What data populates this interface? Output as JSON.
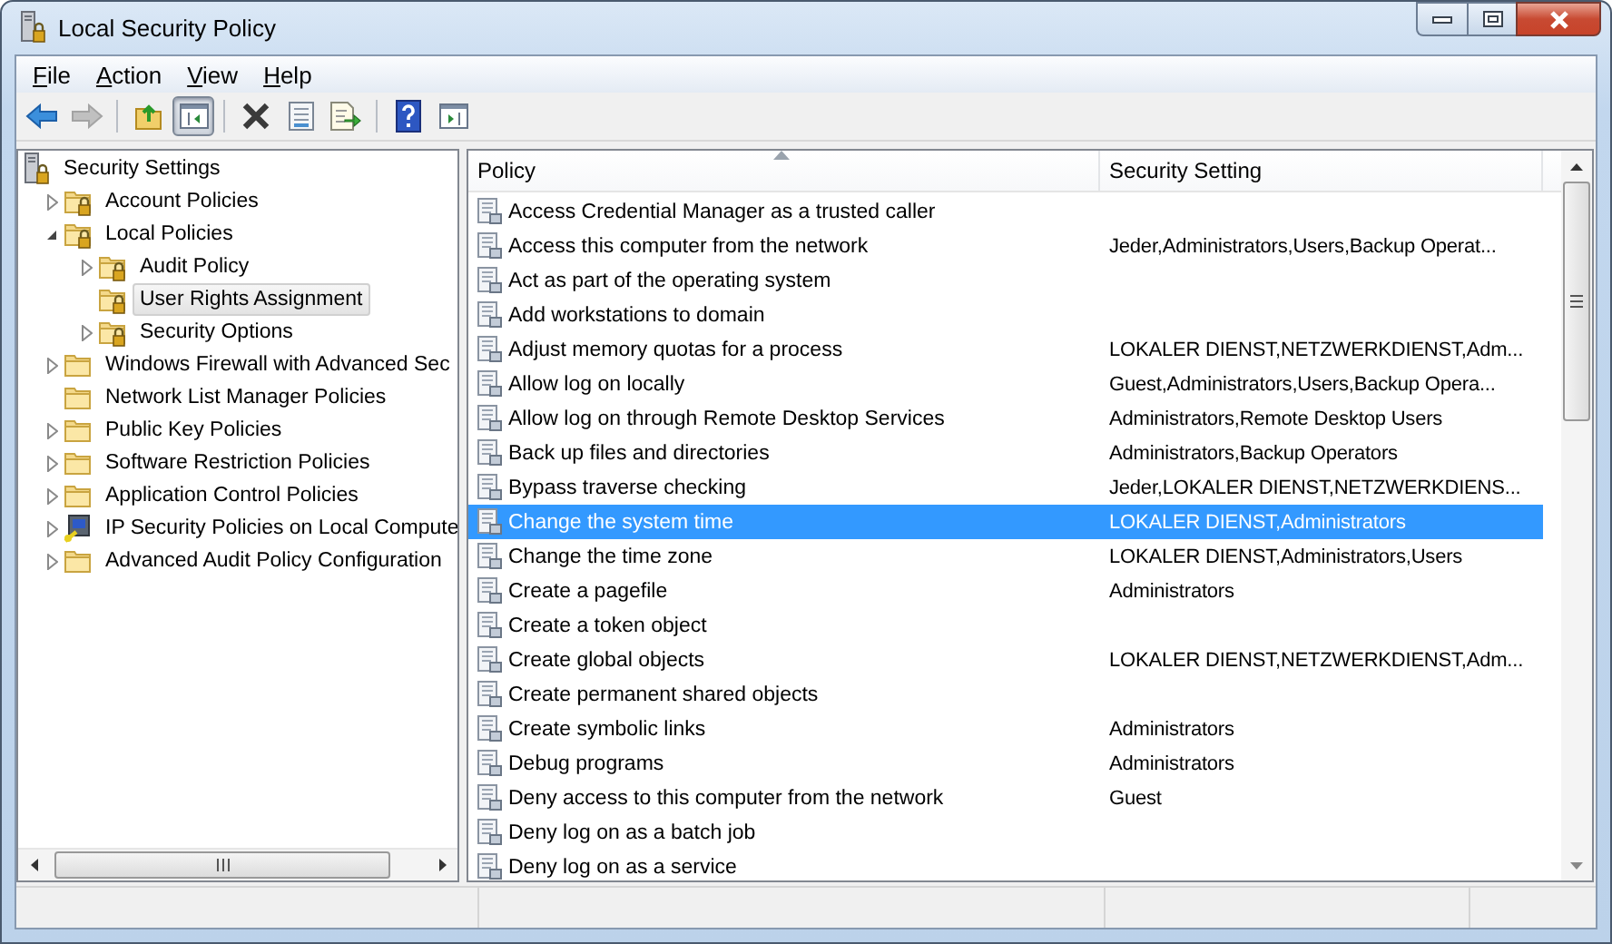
{
  "window": {
    "title": "Local Security Policy"
  },
  "menu": [
    "File",
    "Action",
    "View",
    "Help"
  ],
  "toolbar": [
    {
      "kind": "back",
      "disabled": false,
      "pressed": false
    },
    {
      "kind": "forward",
      "disabled": true,
      "pressed": false
    },
    {
      "kind": "separator"
    },
    {
      "kind": "up",
      "disabled": false,
      "pressed": false
    },
    {
      "kind": "tree-toggle",
      "disabled": false,
      "pressed": true
    },
    {
      "kind": "separator"
    },
    {
      "kind": "delete",
      "disabled": false,
      "pressed": false
    },
    {
      "kind": "properties",
      "disabled": false,
      "pressed": false
    },
    {
      "kind": "export",
      "disabled": false,
      "pressed": false
    },
    {
      "kind": "separator"
    },
    {
      "kind": "help",
      "disabled": false,
      "pressed": false
    },
    {
      "kind": "action-pane",
      "disabled": false,
      "pressed": false
    }
  ],
  "tree": [
    {
      "label": "Security Settings",
      "kind": "root",
      "selected": false,
      "children": [
        {
          "label": "Account Policies",
          "kind": "secure-folder",
          "expanded": false,
          "selected": false
        },
        {
          "label": "Local Policies",
          "kind": "secure-folder",
          "expanded": true,
          "selected": false,
          "children": [
            {
              "label": "Audit Policy",
              "kind": "secure-folder",
              "expanded": false,
              "selected": false
            },
            {
              "label": "User Rights Assignment",
              "kind": "secure-folder",
              "selected": true
            },
            {
              "label": "Security Options",
              "kind": "secure-folder",
              "expanded": false,
              "selected": false
            }
          ]
        },
        {
          "label": "Windows Firewall with Advanced Sec",
          "kind": "folder",
          "expanded": false,
          "selected": false
        },
        {
          "label": "Network List Manager Policies",
          "kind": "folder",
          "selected": false
        },
        {
          "label": "Public Key Policies",
          "kind": "folder",
          "expanded": false,
          "selected": false
        },
        {
          "label": "Software Restriction Policies",
          "kind": "folder",
          "expanded": false,
          "selected": false
        },
        {
          "label": "Application Control Policies",
          "kind": "folder",
          "expanded": false,
          "selected": false
        },
        {
          "label": "IP Security Policies on Local Compute",
          "kind": "ipsec",
          "expanded": false,
          "selected": false
        },
        {
          "label": "Advanced Audit Policy Configuration",
          "kind": "folder",
          "expanded": false,
          "selected": false
        }
      ]
    }
  ],
  "table": {
    "columns": [
      {
        "label": "Policy",
        "sorted": true
      },
      {
        "label": "Security Setting",
        "sorted": false
      }
    ],
    "rows": [
      {
        "policy": "Access Credential Manager as a trusted caller",
        "setting": "",
        "selected": false
      },
      {
        "policy": "Access this computer from the network",
        "setting": "Jeder,Administrators,Users,Backup Operat...",
        "selected": false
      },
      {
        "policy": "Act as part of the operating system",
        "setting": "",
        "selected": false
      },
      {
        "policy": "Add workstations to domain",
        "setting": "",
        "selected": false
      },
      {
        "policy": "Adjust memory quotas for a process",
        "setting": "LOKALER DIENST,NETZWERKDIENST,Adm...",
        "selected": false
      },
      {
        "policy": "Allow log on locally",
        "setting": "Guest,Administrators,Users,Backup Opera...",
        "selected": false
      },
      {
        "policy": "Allow log on through Remote Desktop Services",
        "setting": "Administrators,Remote Desktop Users",
        "selected": false
      },
      {
        "policy": "Back up files and directories",
        "setting": "Administrators,Backup Operators",
        "selected": false
      },
      {
        "policy": "Bypass traverse checking",
        "setting": "Jeder,LOKALER DIENST,NETZWERKDIENS...",
        "selected": false
      },
      {
        "policy": "Change the system time",
        "setting": "LOKALER DIENST,Administrators",
        "selected": true
      },
      {
        "policy": "Change the time zone",
        "setting": "LOKALER DIENST,Administrators,Users",
        "selected": false
      },
      {
        "policy": "Create a pagefile",
        "setting": "Administrators",
        "selected": false
      },
      {
        "policy": "Create a token object",
        "setting": "",
        "selected": false
      },
      {
        "policy": "Create global objects",
        "setting": "LOKALER DIENST,NETZWERKDIENST,Adm...",
        "selected": false
      },
      {
        "policy": "Create permanent shared objects",
        "setting": "",
        "selected": false
      },
      {
        "policy": "Create symbolic links",
        "setting": "Administrators",
        "selected": false
      },
      {
        "policy": "Debug programs",
        "setting": "Administrators",
        "selected": false
      },
      {
        "policy": "Deny access to this computer from the network",
        "setting": "Guest",
        "selected": false
      },
      {
        "policy": "Deny log on as a batch job",
        "setting": "",
        "selected": false
      },
      {
        "policy": "Deny log on as a service",
        "setting": "",
        "selected": false
      }
    ]
  }
}
